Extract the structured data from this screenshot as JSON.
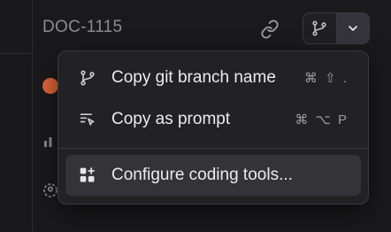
{
  "header": {
    "doc_id": "DOC-1115"
  },
  "icons": {
    "link": "link-icon",
    "branch": "git-branch-icon",
    "chevron": "chevron-down-icon"
  },
  "menu": {
    "items": [
      {
        "label": "Copy git branch name",
        "shortcut": "⌘ ⇧ .",
        "icon": "git-branch-icon"
      },
      {
        "label": "Copy as prompt",
        "shortcut": "⌘ ⌥ P",
        "icon": "prompt-icon"
      },
      {
        "label": "Configure coding tools...",
        "shortcut": "",
        "icon": "apps-plus-icon",
        "highlighted": true
      }
    ]
  },
  "colors": {
    "background": "#1a1a1c",
    "menu_bg": "#222225",
    "highlight": "#333338",
    "accent_orange": "#e0653a"
  }
}
